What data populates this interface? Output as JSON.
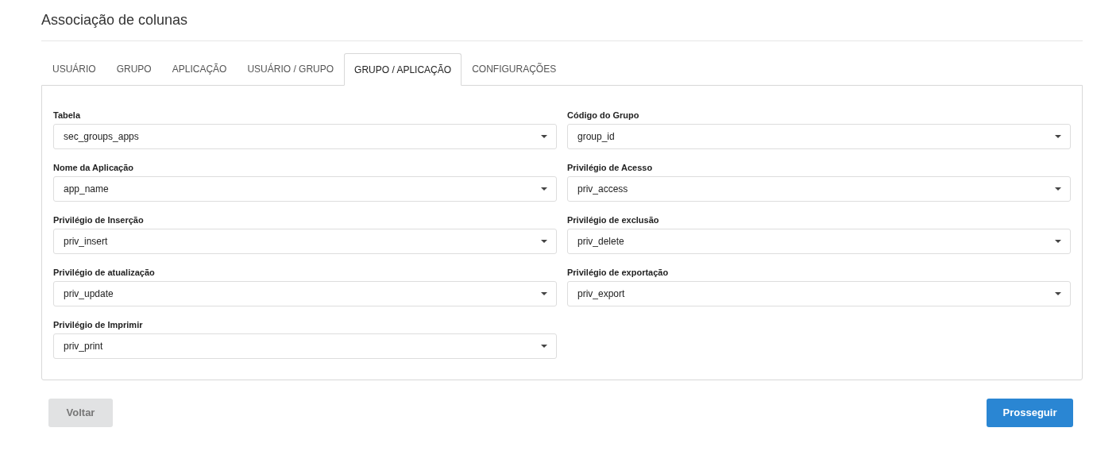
{
  "title": "Associação de colunas",
  "tabs": [
    {
      "label": "USUÁRIO",
      "selected": false
    },
    {
      "label": "GRUPO",
      "selected": false
    },
    {
      "label": "APLICAÇÃO",
      "selected": false
    },
    {
      "label": "USUÁRIO / GRUPO",
      "selected": false
    },
    {
      "label": "GRUPO / APLICAÇÃO",
      "selected": true
    },
    {
      "label": "CONFIGURAÇÕES",
      "selected": false
    }
  ],
  "fields": [
    {
      "label": "Tabela",
      "value": "sec_groups_apps"
    },
    {
      "label": "Código do Grupo",
      "value": "group_id"
    },
    {
      "label": "Nome da Aplicação",
      "value": "app_name"
    },
    {
      "label": "Privilégio de Acesso",
      "value": "priv_access"
    },
    {
      "label": "Privilégio de Inserção",
      "value": "priv_insert"
    },
    {
      "label": "Privilégio de exclusão",
      "value": "priv_delete"
    },
    {
      "label": "Privilégio de atualização",
      "value": "priv_update"
    },
    {
      "label": "Privilégio de exportação",
      "value": "priv_export"
    },
    {
      "label": "Privilégio de Imprimir",
      "value": "priv_print"
    }
  ],
  "buttons": [
    {
      "label": "Voltar",
      "kind": "secondary"
    },
    {
      "label": "Prosseguir",
      "kind": "primary"
    }
  ]
}
